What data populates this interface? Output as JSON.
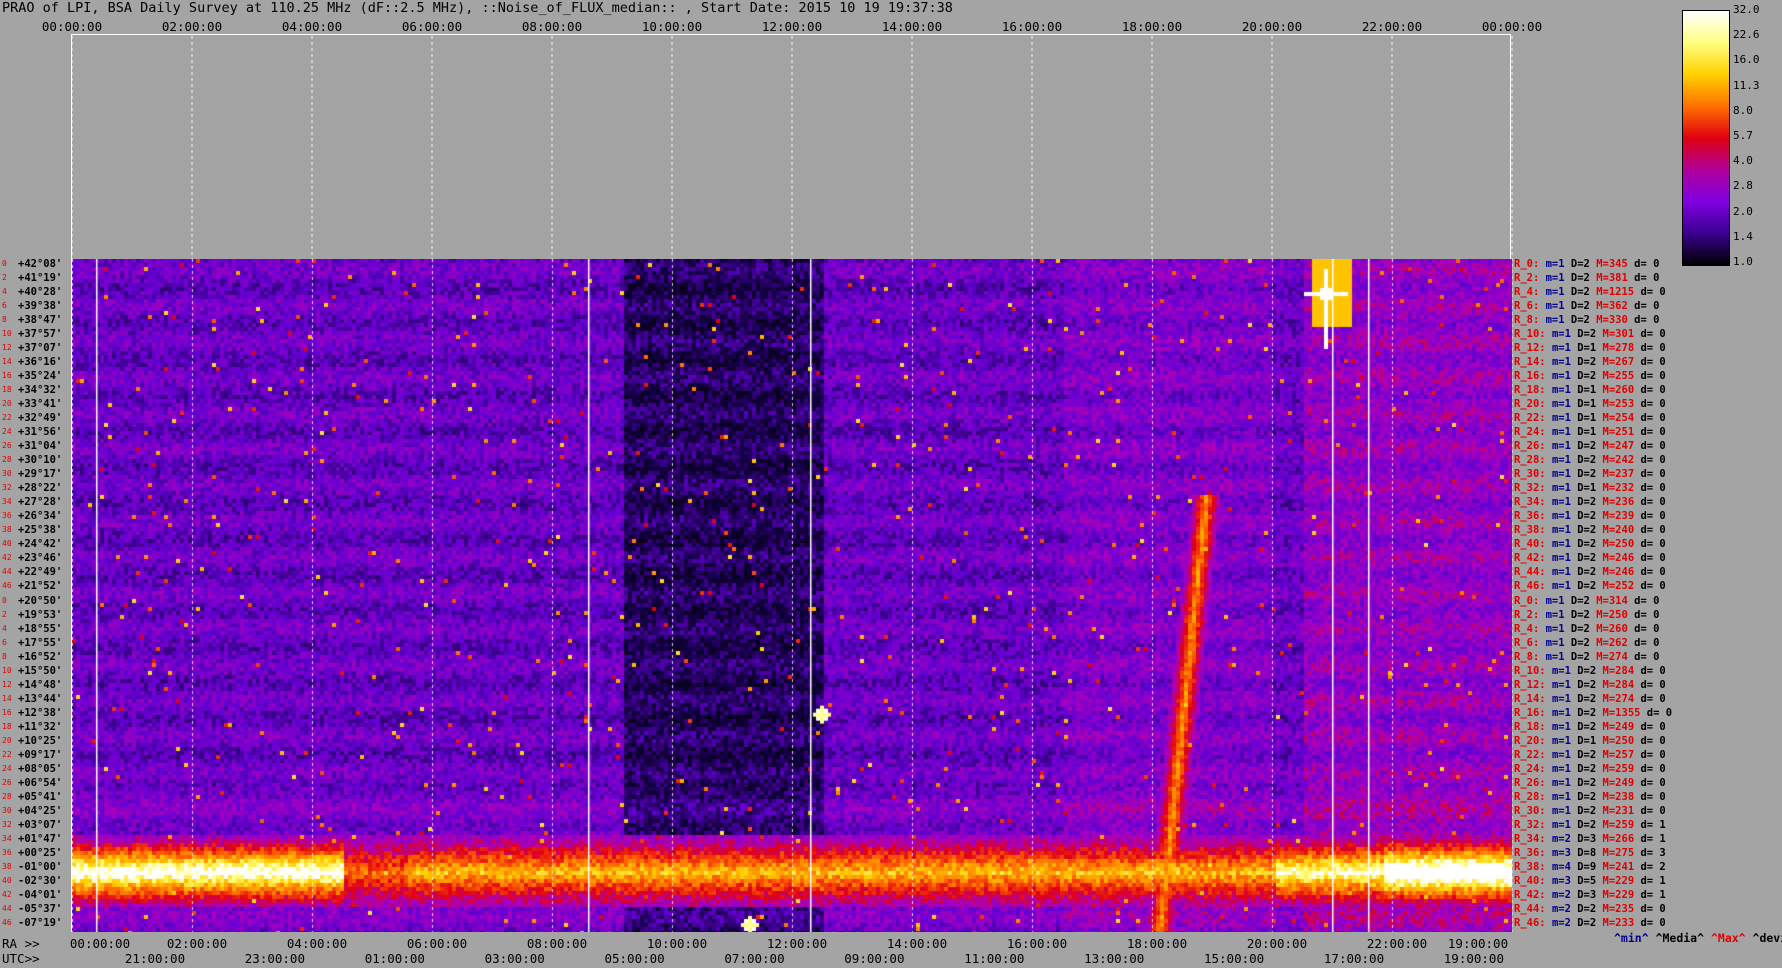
{
  "title": "PRAO of LPI, BSA Daily Survey at 110.25 MHz (dF::2.5 MHz), ::Noise_of_FLUX_median:: , Start Date: 2015 10 19 19:37:38",
  "top_axis_ticks": [
    "00:00:00",
    "02:00:00",
    "04:00:00",
    "06:00:00",
    "08:00:00",
    "10:00:00",
    "12:00:00",
    "14:00:00",
    "16:00:00",
    "18:00:00",
    "20:00:00",
    "22:00:00",
    "00:00:00"
  ],
  "bottom_axis": {
    "ra_prefix": "RA >>",
    "ra_ticks": [
      "00:00:00",
      "02:00:00",
      "04:00:00",
      "06:00:00",
      "08:00:00",
      "10:00:00",
      "12:00:00",
      "14:00:00",
      "16:00:00",
      "18:00:00",
      "20:00:00",
      "22:00:00",
      "19:00:00"
    ],
    "utc_prefix": "UTC>>",
    "utc_ticks": [
      "21:00:00",
      "23:00:00",
      "01:00:00",
      "03:00:00",
      "05:00:00",
      "07:00:00",
      "09:00:00",
      "11:00:00",
      "13:00:00",
      "15:00:00",
      "17:00:00",
      "19:00:00"
    ]
  },
  "colorbar": {
    "labels": [
      "32.0",
      "22.6",
      "16.0",
      "11.3",
      "8.0",
      "5.7",
      "4.0",
      "2.8",
      "2.0",
      "1.4",
      "1.0"
    ],
    "colors": [
      "#ffffff",
      "#ffff80",
      "#ffd000",
      "#ff7000",
      "#e00010",
      "#b0009a",
      "#8000e0",
      "#3a0090",
      "#000000"
    ]
  },
  "legend": {
    "min": "^min^",
    "median": "^Media^",
    "max": "^Max^",
    "dev": "^devia^"
  },
  "chart_data": {
    "type": "heatmap",
    "title": "PRAO of LPI, BSA Daily Survey at 110.25 MHz (dF::2.5 MHz), ::Noise_of_FLUX_median:: , Start Date: 2015 10 19 19:37:38",
    "x_range_hours": [
      0,
      24
    ],
    "color_scale": "log",
    "color_range": [
      1.0,
      32.0
    ],
    "row_declinations": [
      "+42°08'",
      "+41°19'",
      "+40°28'",
      "+39°38'",
      "+38°47'",
      "+37°57'",
      "+37°07'",
      "+36°16'",
      "+35°24'",
      "+34°32'",
      "+33°41'",
      "+32°49'",
      "+31°56'",
      "+31°04'",
      "+30°10'",
      "+29°17'",
      "+28°22'",
      "+27°28'",
      "+26°34'",
      "+25°38'",
      "+24°42'",
      "+23°46'",
      "+22°49'",
      "+21°52'",
      "+20°50'",
      "+19°53'",
      "+18°55'",
      "+17°55'",
      "+16°52'",
      "+15°50'",
      "+14°48'",
      "+13°44'",
      "+12°38'",
      "+11°32'",
      "+10°25'",
      "+09°17'",
      "+08°05'",
      "+06°54'",
      "+05°41'",
      "+04°25'",
      "+03°07'",
      "+01°47'",
      "+00°25'",
      "-01°00'",
      "-02°30'",
      "-04°01'",
      "-05°37'",
      "-07°19'"
    ],
    "row_index_labels": [
      "0",
      "2",
      "4",
      "6",
      "8",
      "10",
      "12",
      "14",
      "16",
      "18",
      "20",
      "22",
      "24",
      "26",
      "28",
      "30",
      "32",
      "34",
      "36",
      "38",
      "40",
      "42",
      "44",
      "46",
      "0",
      "2",
      "4",
      "6",
      "8",
      "10",
      "12",
      "14",
      "16",
      "18",
      "20",
      "22",
      "24",
      "26",
      "28",
      "30",
      "32",
      "34",
      "36",
      "38",
      "40",
      "42",
      "44",
      "46"
    ],
    "row_stats": [
      {
        "r": "R_0:",
        "m": "m=1",
        "D": "D=2",
        "M": "M=345",
        "d": "d= 0"
      },
      {
        "r": "R_2:",
        "m": "m=1",
        "D": "D=2",
        "M": "M=381",
        "d": "d= 0"
      },
      {
        "r": "R_4:",
        "m": "m=1",
        "D": "D=2",
        "M": "M=1215",
        "d": "d= 0"
      },
      {
        "r": "R_6:",
        "m": "m=1",
        "D": "D=2",
        "M": "M=362",
        "d": "d= 0"
      },
      {
        "r": "R_8:",
        "m": "m=1",
        "D": "D=2",
        "M": "M=330",
        "d": "d= 0"
      },
      {
        "r": "R_10:",
        "m": "m=1",
        "D": "D=2",
        "M": "M=301",
        "d": "d= 0"
      },
      {
        "r": "R_12:",
        "m": "m=1",
        "D": "D=1",
        "M": "M=278",
        "d": "d= 0"
      },
      {
        "r": "R_14:",
        "m": "m=1",
        "D": "D=2",
        "M": "M=267",
        "d": "d= 0"
      },
      {
        "r": "R_16:",
        "m": "m=1",
        "D": "D=2",
        "M": "M=255",
        "d": "d= 0"
      },
      {
        "r": "R_18:",
        "m": "m=1",
        "D": "D=1",
        "M": "M=260",
        "d": "d= 0"
      },
      {
        "r": "R_20:",
        "m": "m=1",
        "D": "D=1",
        "M": "M=253",
        "d": "d= 0"
      },
      {
        "r": "R_22:",
        "m": "m=1",
        "D": "D=1",
        "M": "M=254",
        "d": "d= 0"
      },
      {
        "r": "R_24:",
        "m": "m=1",
        "D": "D=1",
        "M": "M=251",
        "d": "d= 0"
      },
      {
        "r": "R_26:",
        "m": "m=1",
        "D": "D=2",
        "M": "M=247",
        "d": "d= 0"
      },
      {
        "r": "R_28:",
        "m": "m=1",
        "D": "D=2",
        "M": "M=242",
        "d": "d= 0"
      },
      {
        "r": "R_30:",
        "m": "m=1",
        "D": "D=2",
        "M": "M=237",
        "d": "d= 0"
      },
      {
        "r": "R_32:",
        "m": "m=1",
        "D": "D=1",
        "M": "M=232",
        "d": "d= 0"
      },
      {
        "r": "R_34:",
        "m": "m=1",
        "D": "D=2",
        "M": "M=236",
        "d": "d= 0"
      },
      {
        "r": "R_36:",
        "m": "m=1",
        "D": "D=2",
        "M": "M=239",
        "d": "d= 0"
      },
      {
        "r": "R_38:",
        "m": "m=1",
        "D": "D=2",
        "M": "M=240",
        "d": "d= 0"
      },
      {
        "r": "R_40:",
        "m": "m=1",
        "D": "D=2",
        "M": "M=250",
        "d": "d= 0"
      },
      {
        "r": "R_42:",
        "m": "m=1",
        "D": "D=2",
        "M": "M=246",
        "d": "d= 0"
      },
      {
        "r": "R_44:",
        "m": "m=1",
        "D": "D=2",
        "M": "M=246",
        "d": "d= 0"
      },
      {
        "r": "R_46:",
        "m": "m=1",
        "D": "D=2",
        "M": "M=252",
        "d": "d= 0"
      },
      {
        "r": "R_0:",
        "m": "m=1",
        "D": "D=2",
        "M": "M=314",
        "d": "d= 0"
      },
      {
        "r": "R_2:",
        "m": "m=1",
        "D": "D=2",
        "M": "M=250",
        "d": "d= 0"
      },
      {
        "r": "R_4:",
        "m": "m=1",
        "D": "D=2",
        "M": "M=260",
        "d": "d= 0"
      },
      {
        "r": "R_6:",
        "m": "m=1",
        "D": "D=2",
        "M": "M=262",
        "d": "d= 0"
      },
      {
        "r": "R_8:",
        "m": "m=1",
        "D": "D=2",
        "M": "M=274",
        "d": "d= 0"
      },
      {
        "r": "R_10:",
        "m": "m=1",
        "D": "D=2",
        "M": "M=284",
        "d": "d= 0"
      },
      {
        "r": "R_12:",
        "m": "m=1",
        "D": "D=2",
        "M": "M=284",
        "d": "d= 0"
      },
      {
        "r": "R_14:",
        "m": "m=1",
        "D": "D=2",
        "M": "M=274",
        "d": "d= 0"
      },
      {
        "r": "R_16:",
        "m": "m=1",
        "D": "D=2",
        "M": "M=1355",
        "d": "d= 0"
      },
      {
        "r": "R_18:",
        "m": "m=1",
        "D": "D=2",
        "M": "M=249",
        "d": "d= 0"
      },
      {
        "r": "R_20:",
        "m": "m=1",
        "D": "D=1",
        "M": "M=250",
        "d": "d= 0"
      },
      {
        "r": "R_22:",
        "m": "m=1",
        "D": "D=2",
        "M": "M=257",
        "d": "d= 0"
      },
      {
        "r": "R_24:",
        "m": "m=1",
        "D": "D=2",
        "M": "M=259",
        "d": "d= 0"
      },
      {
        "r": "R_26:",
        "m": "m=1",
        "D": "D=2",
        "M": "M=249",
        "d": "d= 0"
      },
      {
        "r": "R_28:",
        "m": "m=1",
        "D": "D=2",
        "M": "M=238",
        "d": "d= 0"
      },
      {
        "r": "R_30:",
        "m": "m=1",
        "D": "D=2",
        "M": "M=231",
        "d": "d= 0"
      },
      {
        "r": "R_32:",
        "m": "m=1",
        "D": "D=2",
        "M": "M=259",
        "d": "d= 1"
      },
      {
        "r": "R_34:",
        "m": "m=2",
        "D": "D=3",
        "M": "M=266",
        "d": "d= 1"
      },
      {
        "r": "R_36:",
        "m": "m=3",
        "D": "D=8",
        "M": "M=275",
        "d": "d= 3"
      },
      {
        "r": "R_38:",
        "m": "m=4",
        "D": "D=9",
        "M": "M=241",
        "d": "d= 2"
      },
      {
        "r": "R_40:",
        "m": "m=3",
        "D": "D=5",
        "M": "M=229",
        "d": "d= 1"
      },
      {
        "r": "R_42:",
        "m": "m=2",
        "D": "D=3",
        "M": "M=229",
        "d": "d= 1"
      },
      {
        "r": "R_44:",
        "m": "m=2",
        "D": "D=2",
        "M": "M=235",
        "d": "d= 0"
      },
      {
        "r": "R_46:",
        "m": "m=2",
        "D": "D=2",
        "M": "M=233",
        "d": "d= 0"
      }
    ],
    "features": [
      {
        "kind": "bright-band",
        "rows": [
          41,
          46
        ],
        "hours": [
          [
            0.2,
            4.5
          ],
          [
            5.5,
            24
          ]
        ],
        "level": "high"
      },
      {
        "kind": "source-track",
        "hours_start": 19.3,
        "hours_end": 18.1,
        "rows": [
          1,
          46
        ],
        "level": "high"
      },
      {
        "kind": "point-source",
        "hours": 20.9,
        "row": 2,
        "level": "max"
      },
      {
        "kind": "point-source",
        "hours": 12.5,
        "row": 32,
        "level": "max"
      },
      {
        "kind": "point-source",
        "hours": 11.3,
        "row": 47,
        "level": "max"
      }
    ]
  }
}
